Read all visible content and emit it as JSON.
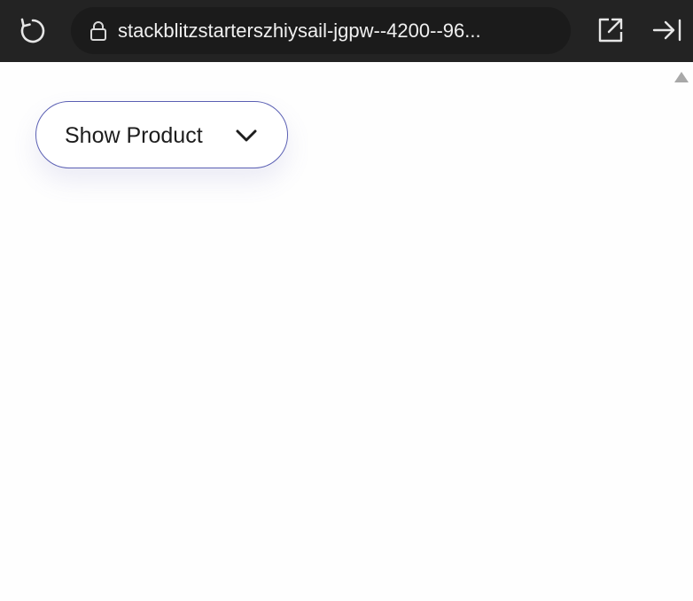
{
  "browser": {
    "url": "stackblitzstarterszhiysail-jgpw--4200--96...",
    "icons": {
      "reload": "reload-icon",
      "lock": "lock-icon",
      "open_external": "open-external-icon",
      "collapse": "collapse-right-icon",
      "scroll_up": "scroll-up-icon"
    }
  },
  "page": {
    "dropdown": {
      "label": "Show Product",
      "icon": "chevron-down-icon"
    }
  },
  "colors": {
    "topbar": "#232323",
    "urlbar": "#1b1b1b",
    "button_border": "#5a5fb3"
  }
}
